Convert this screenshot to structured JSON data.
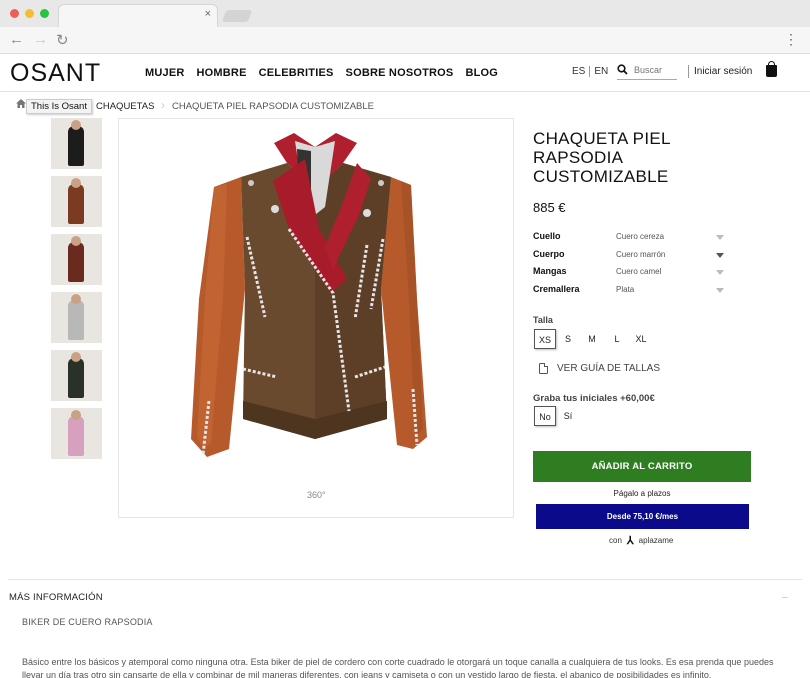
{
  "browser": {
    "traffic_colors": [
      "#ed5f56",
      "#f5bd2f",
      "#27c53f"
    ],
    "tab_close": "×",
    "menu_dots": "⋮"
  },
  "header": {
    "logo": "OSANT",
    "nav": [
      "MUJER",
      "HOMBRE",
      "CELEBRITIES",
      "SOBRE NOSOTROS",
      "BLOG"
    ],
    "lang_es": "ES",
    "lang_en": "EN",
    "search_placeholder": "Buscar",
    "login": "Iniciar sesión"
  },
  "breadcrumb": {
    "home_tooltip": "This Is Osant",
    "category": "CHAQUETAS",
    "current": "CHAQUETA PIEL RAPSODIA CUSTOMIZABLE"
  },
  "gallery": {
    "thumb_colors": [
      "#1c1c1c",
      "#7a3b22",
      "#6b2a1e",
      "#b8b8b8",
      "#2a3128",
      "#d8a0bf"
    ],
    "rotate_label": "360°"
  },
  "product": {
    "title": "CHAQUETA PIEL RAPSODIA CUSTOMIZABLE",
    "price": "885 €",
    "options": [
      {
        "label": "Cuello",
        "value": "Cuero cereza"
      },
      {
        "label": "Cuerpo",
        "value": "Cuero marrón"
      },
      {
        "label": "Mangas",
        "value": "Cuero camel"
      },
      {
        "label": "Cremallera",
        "value": "Plata"
      }
    ],
    "size_label": "Talla",
    "sizes": [
      "XS",
      "S",
      "M",
      "L",
      "XL"
    ],
    "selected_size": "XS",
    "size_guide": "VER GUÍA DE TALLAS",
    "engrave_label": "Graba tus iniciales +60,00€",
    "engrave_options": [
      "No",
      "Sí"
    ],
    "add_to_cart": "AÑADIR AL CARRITO",
    "pay_later": "Págalo a plazos",
    "installment_button": "Desde 75,10 €/mes",
    "with_label": "con",
    "aplazame": "aplazame",
    "cart_color": "#2f7d21",
    "installment_color": "#0a0a8a"
  },
  "more_info": {
    "title": "MÁS INFORMACIÓN",
    "toggle": "–",
    "subtitle": "BIKER DE CUERO RAPSODIA",
    "description": "Básico entre los básicos y atemporal como ninguna otra. Esta biker de piel de cordero con corte cuadrado le otorgará un toque canalla a cualquiera de tus looks. Es esa prenda que puedes llevar un día tras otro sin cansarte de ella y combinar de mil maneras diferentes, con jeans y camiseta o con un vestido largo de fiesta, el abanico de posibilidades es infinito."
  }
}
